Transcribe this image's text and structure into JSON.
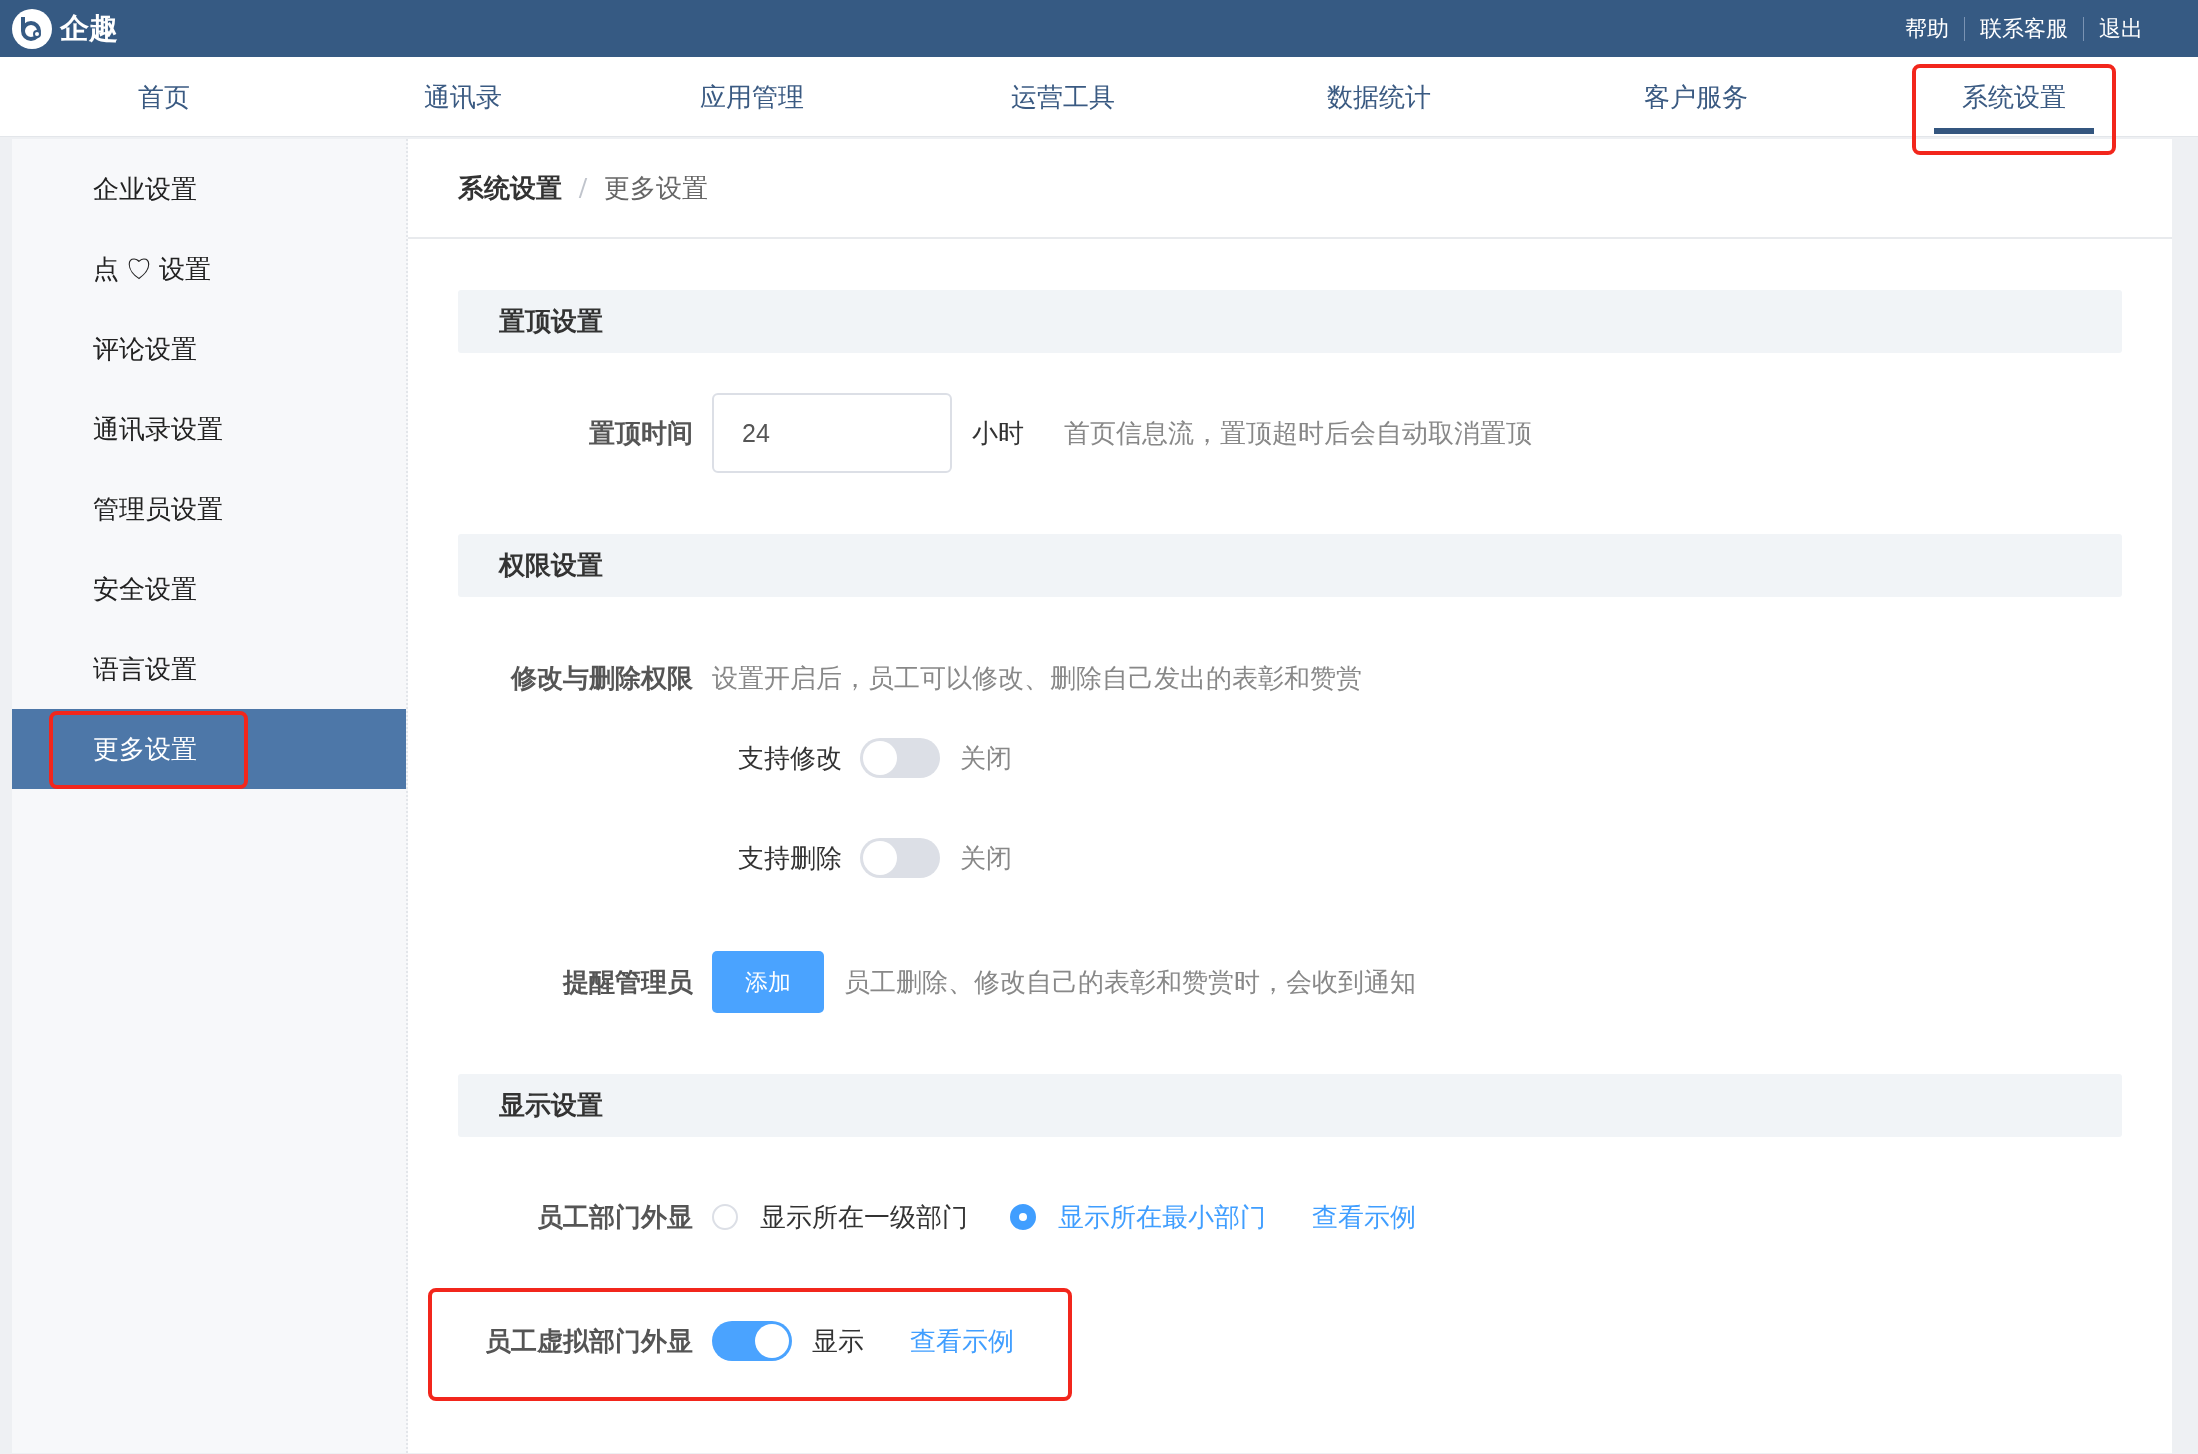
{
  "header": {
    "brand": "企趣",
    "links": [
      "帮助",
      "联系客服",
      "退出"
    ]
  },
  "nav": [
    {
      "label": "首页",
      "selected": false,
      "highlighted": false
    },
    {
      "label": "通讯录",
      "selected": false,
      "highlighted": false
    },
    {
      "label": "应用管理",
      "selected": false,
      "highlighted": false
    },
    {
      "label": "运营工具",
      "selected": false,
      "highlighted": false
    },
    {
      "label": "数据统计",
      "selected": false,
      "highlighted": false
    },
    {
      "label": "客户服务",
      "selected": false,
      "highlighted": false
    },
    {
      "label": "系统设置",
      "selected": true,
      "highlighted": true
    }
  ],
  "sidebar": {
    "items": [
      {
        "label": "企业设置",
        "selected": false,
        "highlighted": false
      },
      {
        "label": "点 ♡ 设置",
        "selected": false,
        "highlighted": false
      },
      {
        "label": "评论设置",
        "selected": false,
        "highlighted": false
      },
      {
        "label": "通讯录设置",
        "selected": false,
        "highlighted": false
      },
      {
        "label": "管理员设置",
        "selected": false,
        "highlighted": false
      },
      {
        "label": "安全设置",
        "selected": false,
        "highlighted": false
      },
      {
        "label": "语言设置",
        "selected": false,
        "highlighted": false
      },
      {
        "label": "更多设置",
        "selected": true,
        "highlighted": true
      }
    ]
  },
  "breadcrumb": [
    "系统设置",
    "更多设置"
  ],
  "sections": [
    {
      "title": "置顶设置",
      "rows": [
        {
          "kind": "input",
          "label": "置顶时间",
          "value": "24",
          "unit": "小时",
          "hint": "首页信息流，置顶超时后会自动取消置顶"
        }
      ]
    },
    {
      "title": "权限设置",
      "rows": [
        {
          "kind": "description",
          "label": "修改与删除权限",
          "text": "设置开启后，员工可以修改、删除自己发出的表彰和赞赏"
        },
        {
          "kind": "subtoggle",
          "label": "支持修改",
          "on": false,
          "status": "关闭"
        },
        {
          "kind": "subtoggle",
          "label": "支持删除",
          "on": false,
          "status": "关闭"
        },
        {
          "kind": "button",
          "label": "提醒管理员",
          "button": "添加",
          "hint": "员工删除、修改自己的表彰和赞赏时，会收到通知"
        }
      ]
    },
    {
      "title": "显示设置",
      "rows": [
        {
          "kind": "radio",
          "label": "员工部门外显",
          "options": [
            {
              "label": "显示所在一级部门",
              "selected": false
            },
            {
              "label": "显示所在最小部门",
              "selected": true
            }
          ],
          "link": "查看示例"
        },
        {
          "kind": "toggle",
          "label": "员工虚拟部门外显",
          "on": true,
          "status": "显示",
          "link": "查看示例",
          "highlighted": true
        }
      ]
    }
  ]
}
